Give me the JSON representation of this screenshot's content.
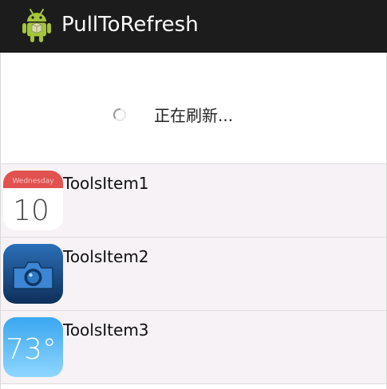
{
  "action_bar": {
    "title": "PullToRefresh",
    "icon": "android-robot-icon"
  },
  "refresh_header": {
    "status_text": "正在刷新...",
    "icon": "loading-spinner-icon"
  },
  "list": {
    "items": [
      {
        "label": "ToolsItem1",
        "icon": "calendar-icon",
        "icon_weekday": "Wednesday",
        "icon_day": "10"
      },
      {
        "label": "ToolsItem2",
        "icon": "camera-icon"
      },
      {
        "label": "ToolsItem3",
        "icon": "weather-icon",
        "icon_temperature": "73°"
      }
    ]
  },
  "colors": {
    "action_bar_bg": "#1c1c1c",
    "list_item_bg": "#f6f2f5",
    "android_green": "#a4c639"
  }
}
